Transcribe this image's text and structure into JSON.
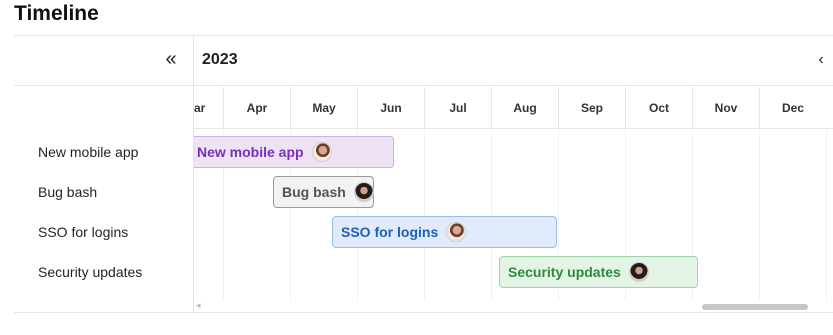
{
  "page": {
    "title": "Timeline"
  },
  "header": {
    "year": "2023",
    "collapse_icon": "«",
    "prev_icon": "‹"
  },
  "months": [
    "ar",
    "Apr",
    "May",
    "Jun",
    "Jul",
    "Aug",
    "Sep",
    "Oct",
    "Nov",
    "Dec"
  ],
  "projects": [
    {
      "name": "New mobile app",
      "bar_label": "New mobile app",
      "bg": "#ede3f5",
      "border": "#c9b2e0",
      "text": "#7a2fb8"
    },
    {
      "name": "Bug bash",
      "bar_label": "Bug bash",
      "bg": "#f2f2f2",
      "border": "#9a9a9a",
      "text": "#555555"
    },
    {
      "name": "SSO for logins",
      "bar_label": "SSO for logins",
      "bg": "#dfeafb",
      "border": "#9dbde8",
      "text": "#1f5fb8"
    },
    {
      "name": "Security updates",
      "bar_label": "Security updates",
      "bg": "#e3f4e6",
      "border": "#9fd3aa",
      "text": "#2e8a3a"
    }
  ],
  "scrollbar": {
    "left_arrow": "◂"
  }
}
